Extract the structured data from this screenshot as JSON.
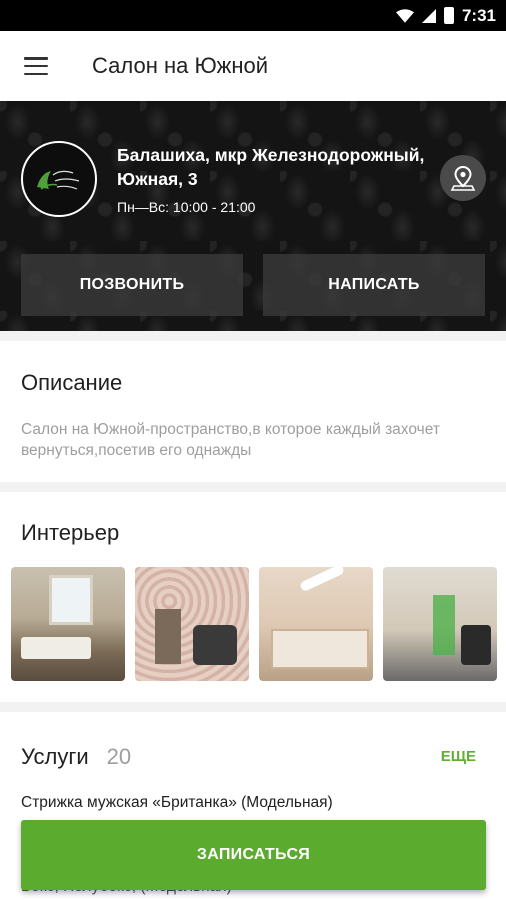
{
  "status_bar": {
    "time": "7:31"
  },
  "app_bar": {
    "title": "Салон на Южной",
    "menu_icon": "hamburger-menu-icon"
  },
  "header": {
    "logo_icon": "salon-logo",
    "address": "Балашиха, мкр Железнодорожный, Южная, 3",
    "hours": "Пн—Вс: 10:00 - 21:00",
    "map_icon": "map-pin-icon",
    "call_label": "ПОЗВОНИТЬ",
    "write_label": "НАПИСАТЬ"
  },
  "description": {
    "title": "Описание",
    "text": "Салон на Южной-пространство,в которое каждый захочет вернуться,посетив его однажды"
  },
  "interior": {
    "title": "Интерьер",
    "photos": [
      "interior-photo-1",
      "interior-photo-2",
      "interior-photo-3",
      "interior-photo-4"
    ]
  },
  "services": {
    "title": "Услуги",
    "count": "20",
    "more_label": "ЕЩЕ",
    "items": [
      "Стрижка мужская «Британка» (Модельная)",
      "Бокс, Полубокс, (Модельная)"
    ]
  },
  "cta": {
    "label": "ЗАПИСАТЬСЯ"
  },
  "colors": {
    "accent": "#5aab2e",
    "header_bg": "#141414",
    "link": "#5fb033"
  }
}
